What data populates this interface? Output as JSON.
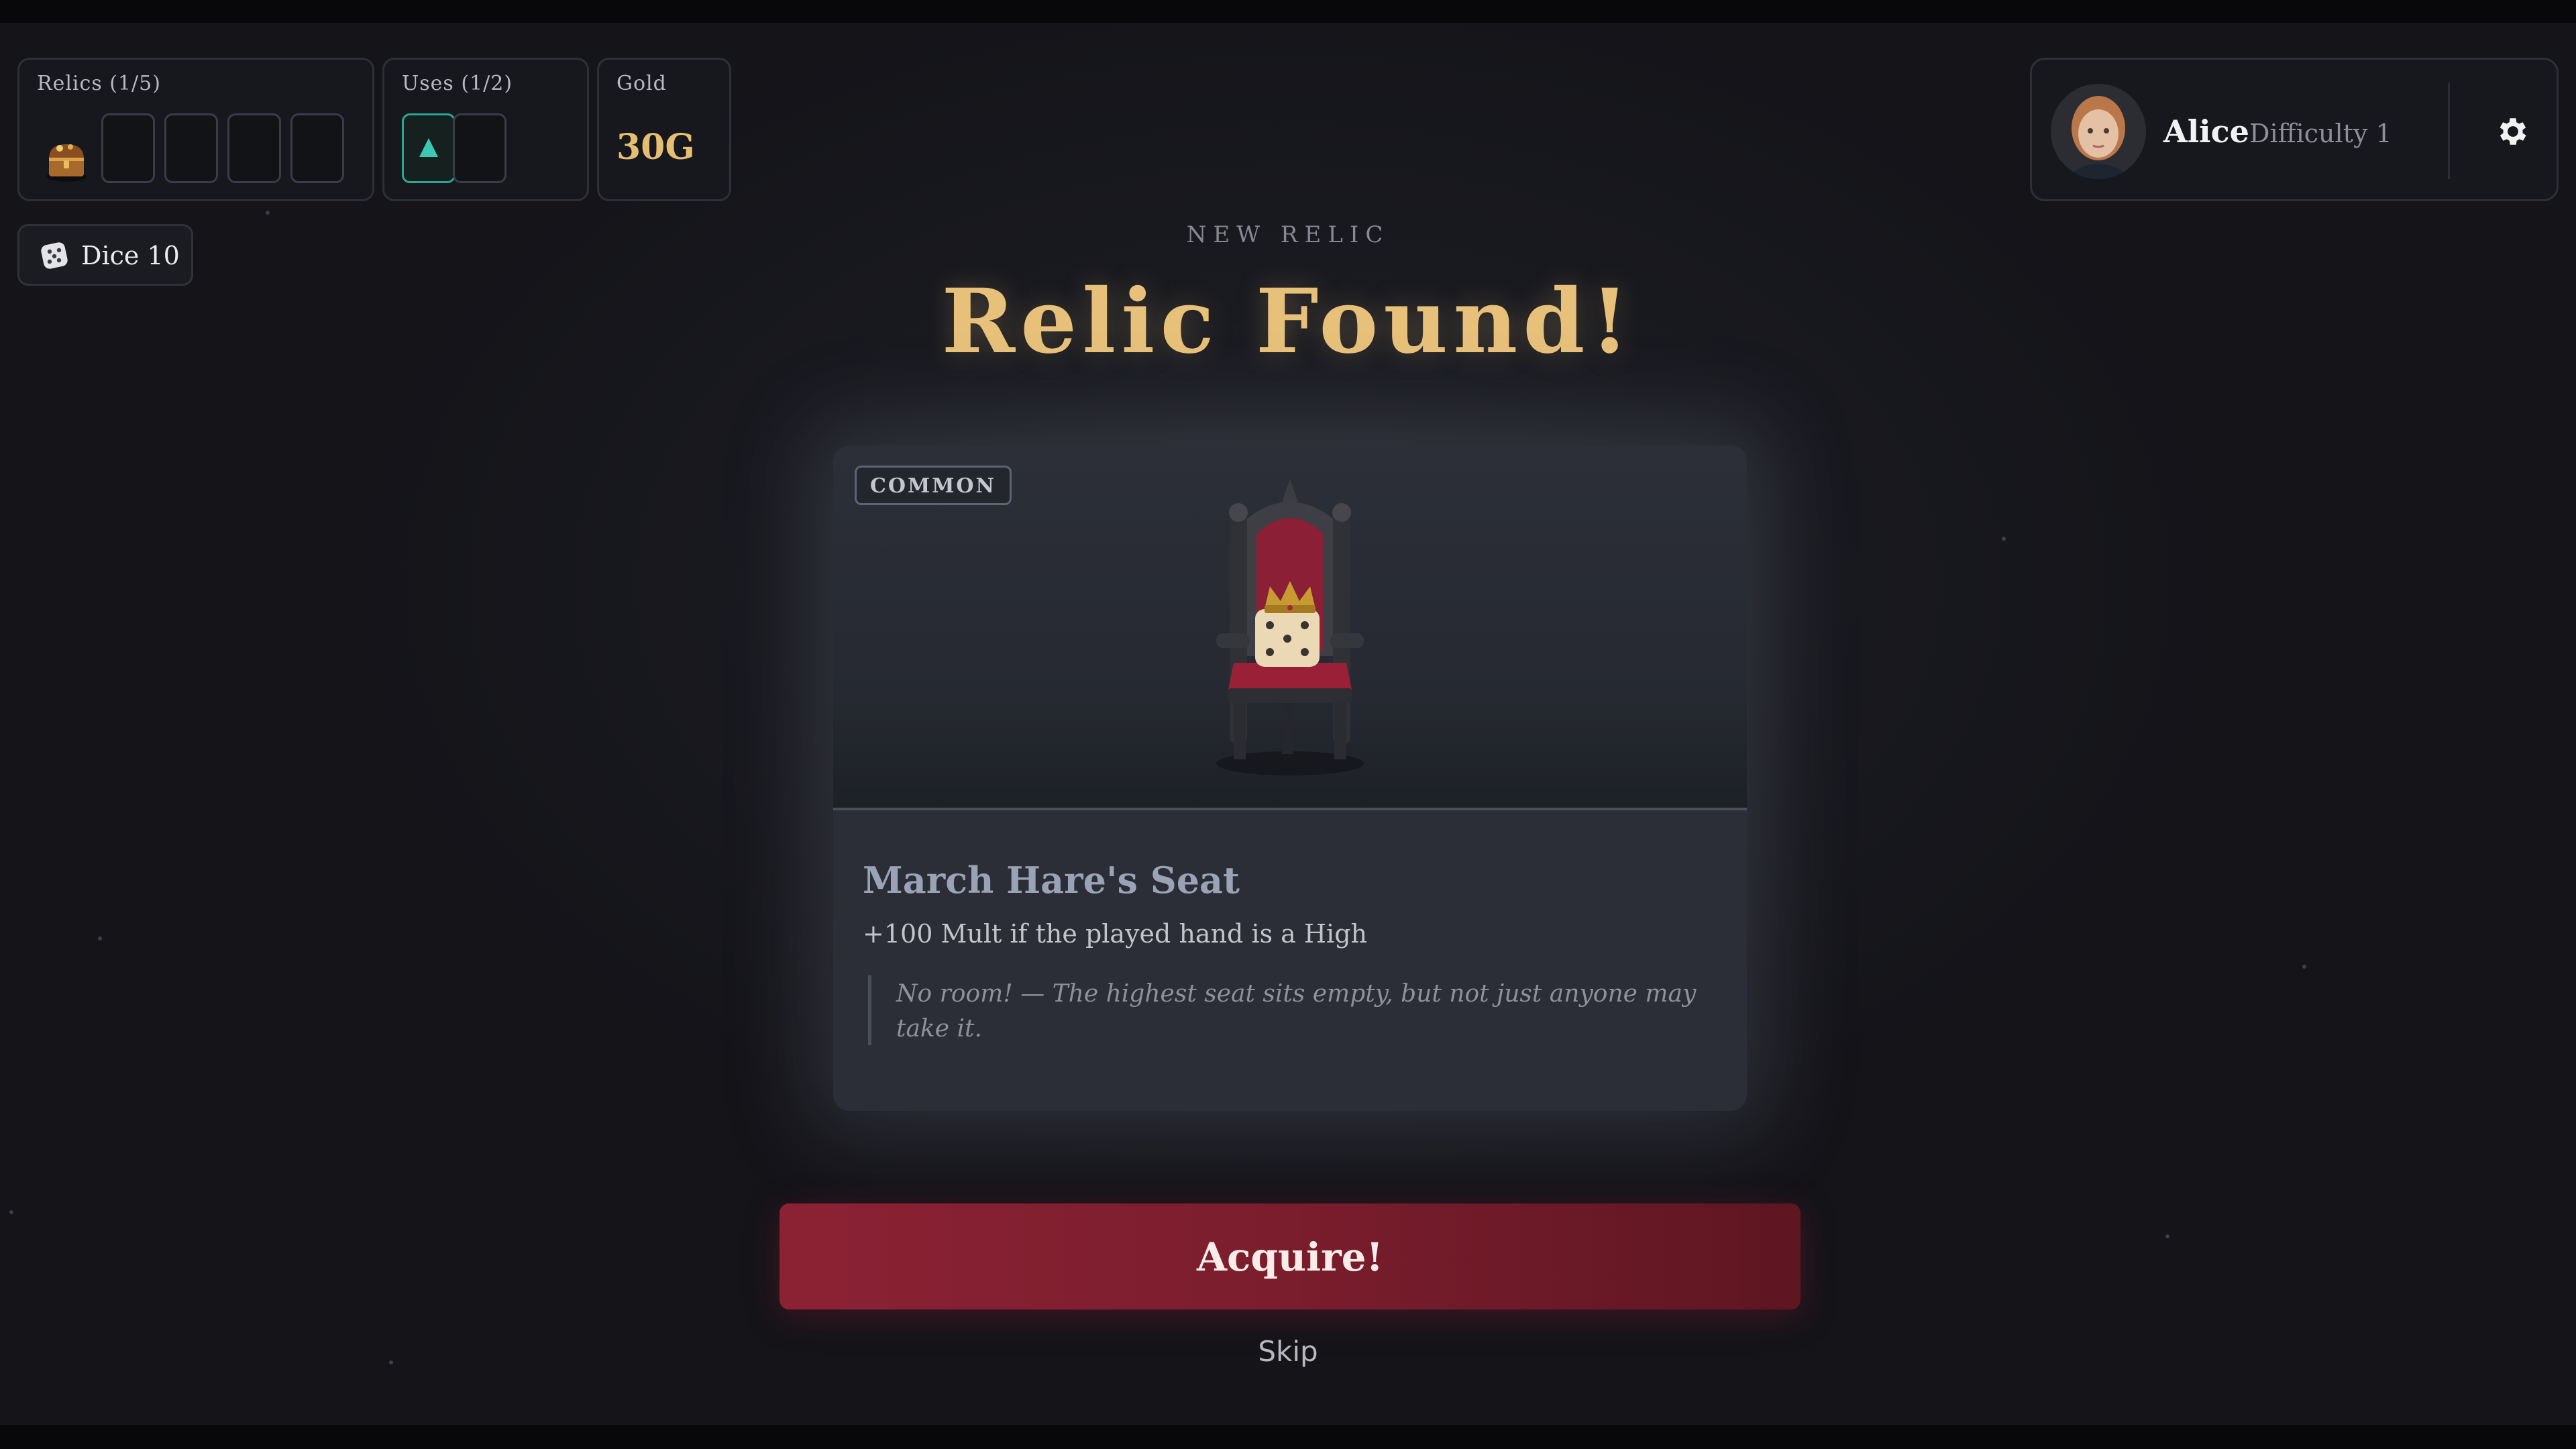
{
  "hud": {
    "relics_label": "Relics (1/5)",
    "uses_label": "Uses (1/2)",
    "gold_label": "Gold",
    "gold_value": "30G",
    "dice_label": "Dice 10"
  },
  "profile": {
    "name": "Alice",
    "difficulty": "Difficulty 1"
  },
  "reward": {
    "kicker": "NEW RELIC",
    "title": "Relic Found!"
  },
  "relic": {
    "rarity": "COMMON",
    "name": "March Hare's Seat",
    "effect": "+100 Mult if the played hand is a High",
    "flavor": "No room! — The highest seat sits empty, but not just anyone may take it."
  },
  "actions": {
    "acquire_label": "Acquire!",
    "skip_label": "Skip"
  },
  "icons": {
    "relic_slot_1": "treasure-chest-icon",
    "use_slot_1": "triangle-icon",
    "dice": "die-icon",
    "settings": "gear-icon"
  },
  "colors": {
    "accent_gold": "#e7c07a",
    "acquire_red": "#8b2234",
    "use_teal": "#2aa896"
  }
}
